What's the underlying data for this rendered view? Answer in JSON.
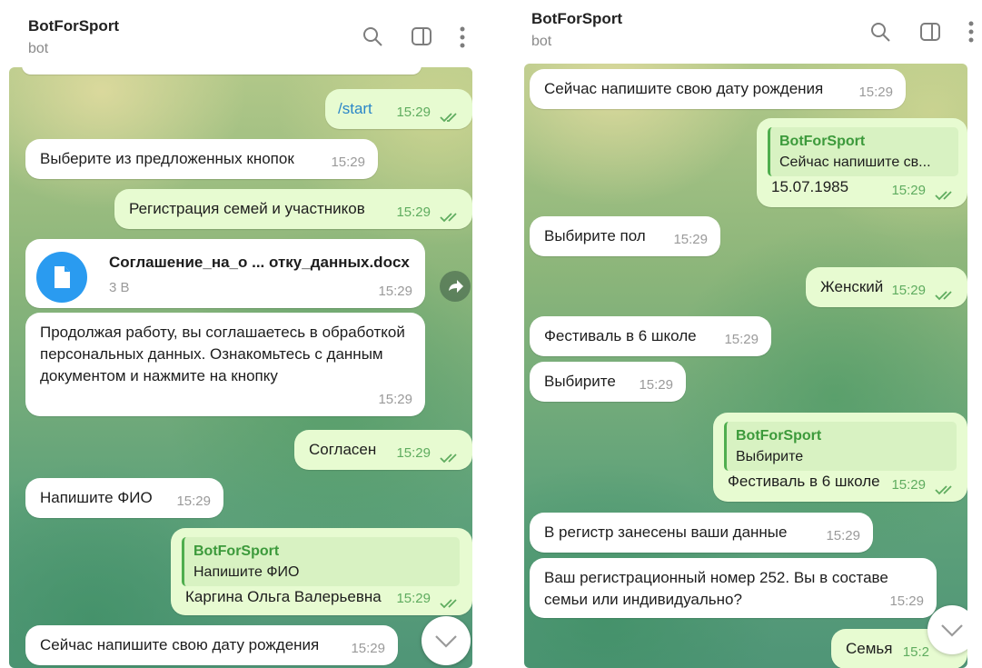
{
  "left": {
    "header": {
      "title": "BotForSport",
      "subtitle": "bot"
    },
    "messages": {
      "m1": {
        "text": "/start",
        "time": "15:29"
      },
      "m2": {
        "text": "Выберите из предложенных кнопок",
        "time": "15:29"
      },
      "m3": {
        "text": "Регистрация семей и участников",
        "time": "15:29"
      },
      "m4": {
        "filename": "Соглашение_на_о ... отку_данных.docx",
        "size": "3 B",
        "time": "15:29"
      },
      "m5": {
        "text": "Продолжая работу, вы соглашаетесь в обработкой персональных данных. Ознакомьтесь с данным документом и нажмите на кнопку",
        "time": "15:29"
      },
      "m6": {
        "text": "Согласен",
        "time": "15:29"
      },
      "m7": {
        "text": "Напишите ФИО",
        "time": "15:29"
      },
      "m8": {
        "quote_name": "BotForSport",
        "quote_text": "Напишите ФИО",
        "text": "Каргина Ольга Валерьевна",
        "time": "15:29"
      },
      "m9": {
        "text": "Сейчас напишите свою дату рождения",
        "time": "15:29"
      }
    }
  },
  "right": {
    "header": {
      "title": "BotForSport",
      "subtitle": "bot"
    },
    "messages": {
      "m1": {
        "text": "Сейчас напишите свою дату рождения",
        "time": "15:29"
      },
      "m2": {
        "quote_name": "BotForSport",
        "quote_text": "Сейчас напишите св...",
        "text": "15.07.1985",
        "time": "15:29"
      },
      "m3": {
        "text": "Выбирите пол",
        "time": "15:29"
      },
      "m4": {
        "text": "Женский",
        "time": "15:29"
      },
      "m5": {
        "text": "Фестиваль в 6 школе",
        "time": "15:29"
      },
      "m6": {
        "text": "Выбирите",
        "time": "15:29"
      },
      "m7": {
        "quote_name": "BotForSport",
        "quote_text": "Выбирите",
        "text": "Фестиваль в 6 школе",
        "time": "15:29"
      },
      "m8": {
        "text": "В регистр занесены  ваши данные",
        "time": "15:29"
      },
      "m9": {
        "text": "Ваш регистрационный номер 252. Вы в составе семьи или индивидуально?",
        "time": "15:29"
      },
      "m10": {
        "text": "Семья",
        "time": "15:2"
      }
    }
  },
  "icons": [
    "search-icon",
    "sidebar-toggle-icon",
    "more-vertical-icon",
    "double-check-icon",
    "document-icon",
    "forward-icon",
    "chevron-down-icon"
  ],
  "colors": {
    "outgoing": "#e7fbd1",
    "incoming": "#ffffff",
    "accent_green": "#4fae4e",
    "link_blue": "#2a86c8",
    "doc_blue": "#2a9bf0"
  }
}
